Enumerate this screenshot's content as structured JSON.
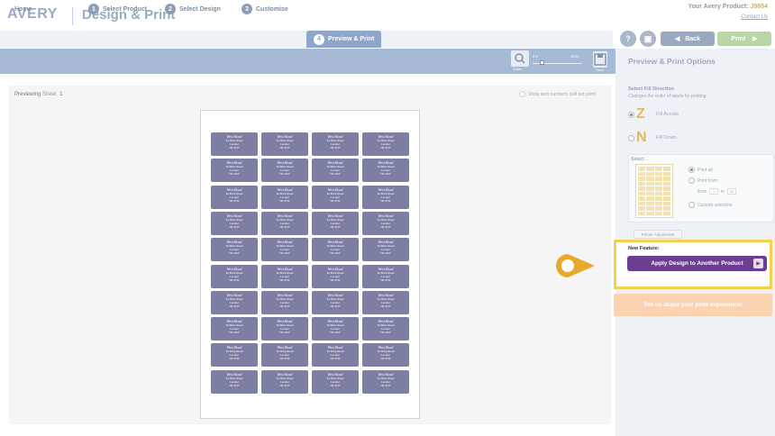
{
  "header": {
    "logo": "AVERY",
    "app_title": "Design & Print",
    "product_label": "Your Avery Product:",
    "product_code": "J8654",
    "contact": "Contact Us"
  },
  "steps": [
    {
      "num": "",
      "label": "Home"
    },
    {
      "num": "1",
      "label": "Select Product"
    },
    {
      "num": "2",
      "label": "Select Design"
    },
    {
      "num": "3",
      "label": "Customise"
    },
    {
      "num": "4",
      "label": "Preview & Print"
    }
  ],
  "nav_buttons": {
    "help": "?",
    "back": "Back",
    "print": "Print"
  },
  "toolbar": {
    "zoom_label": "Zoom",
    "zoom_min": "0%",
    "zoom_max": "400%",
    "zoom_level_fraction": 0.18,
    "save_label": "Save"
  },
  "preview": {
    "previewing": "Previewing",
    "sheet_word": "Sheet",
    "sheet_number": "1",
    "show_numbers": "Show item numbers (will not print)"
  },
  "label": {
    "title": "West Road",
    "line1": "34 West Road",
    "line2": "London",
    "line3": "N6 3TW"
  },
  "panel": {
    "title": "Preview & Print Options",
    "fill_heading": "Select Fill Direction",
    "fill_sub": "Changes the order of labels for printing",
    "fill_across": "Fill Across",
    "fill_down": "Fill Down",
    "select_heading": "Select",
    "print_all": "Print all",
    "print_from": "Print from:",
    "from_word": "from",
    "from_value": "1",
    "to_word": "to",
    "to_value": "40",
    "custom_selection": "Custom selection",
    "printer_adjustment": "Printer Adjustment",
    "new_feature": "New Feature:",
    "apply_design": "Apply Design to Another Product",
    "tell_us": "Tell us about your print experience!"
  },
  "colors": {
    "accent": "#9aa9c4",
    "label_fill": "#7d7ea3",
    "feature_button": "#6c3e92",
    "highlight": "#f1d24a",
    "pointer": "#e9a92a"
  }
}
